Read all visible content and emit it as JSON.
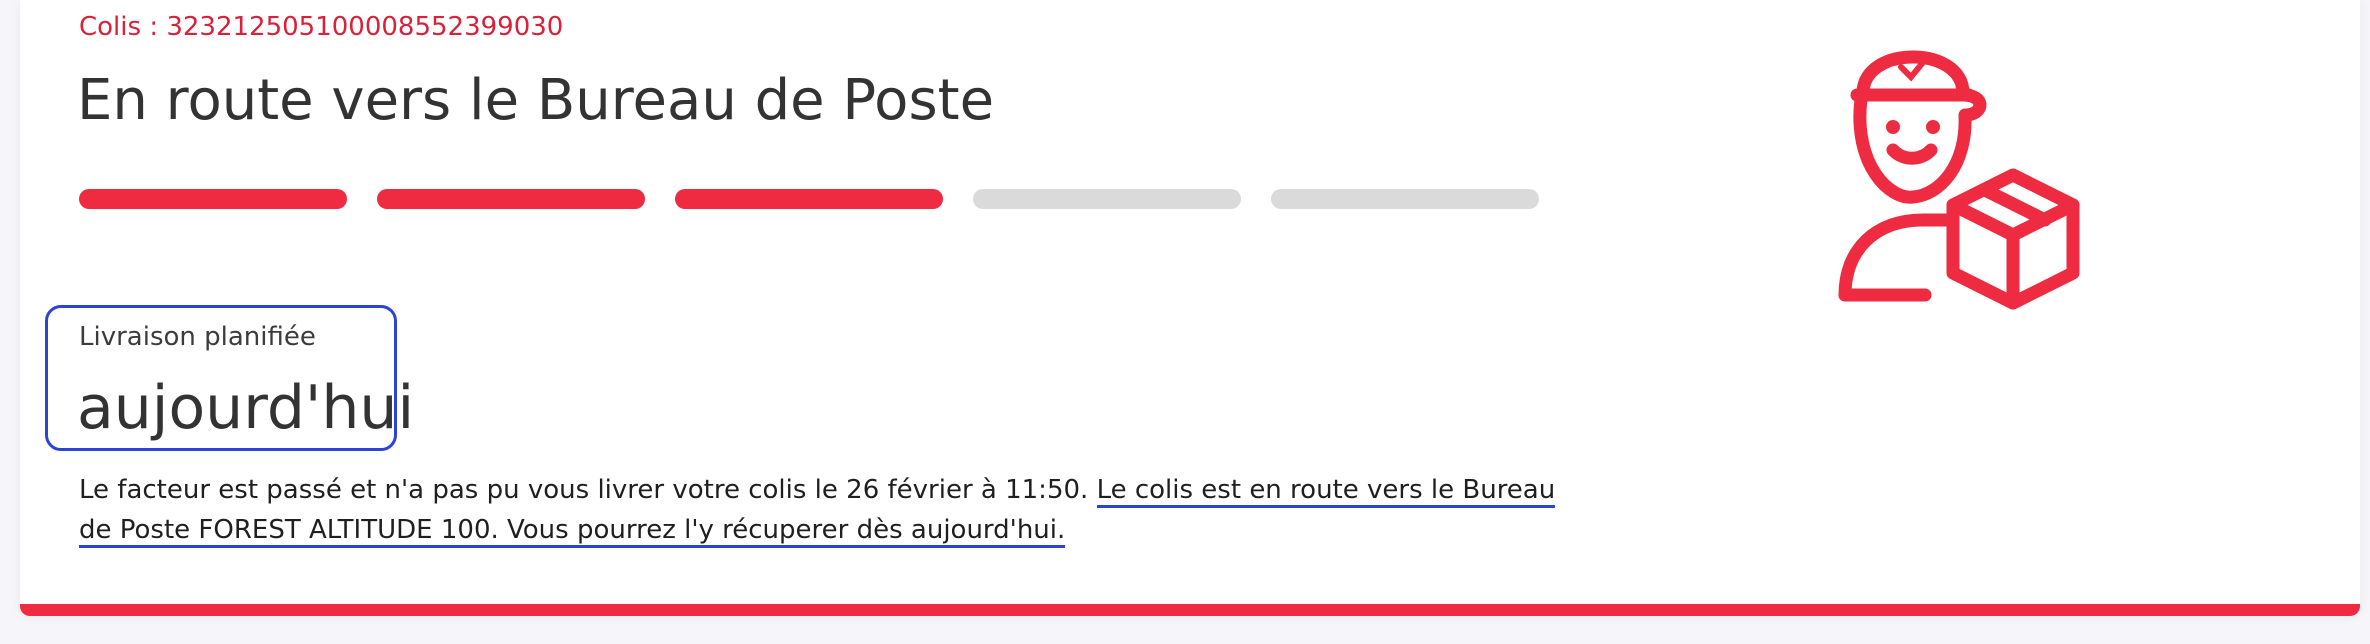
{
  "parcel": {
    "id_label": "Colis : 323212505100008552399030",
    "status_title": "En route vers le Bureau de Poste"
  },
  "progress": {
    "total_steps": 5,
    "completed_steps": 3
  },
  "planned_delivery": {
    "label": "Livraison planifiée",
    "value": "aujourd'hui"
  },
  "message": {
    "text": "Le facteur est passé et n'a pas pu vous livrer votre colis le 26 février à 11:50. ",
    "link_text": "Le colis est en route vers le Bureau de Poste FOREST ALTITUDE 100. Vous pourrez l'y récuperer dès aujourd'hui."
  },
  "illustration": {
    "icon": "courier-with-package-icon"
  },
  "colors": {
    "accent": "#ee2b40",
    "focus_outline": "#2b44d6",
    "progress_inactive": "#dadada"
  }
}
